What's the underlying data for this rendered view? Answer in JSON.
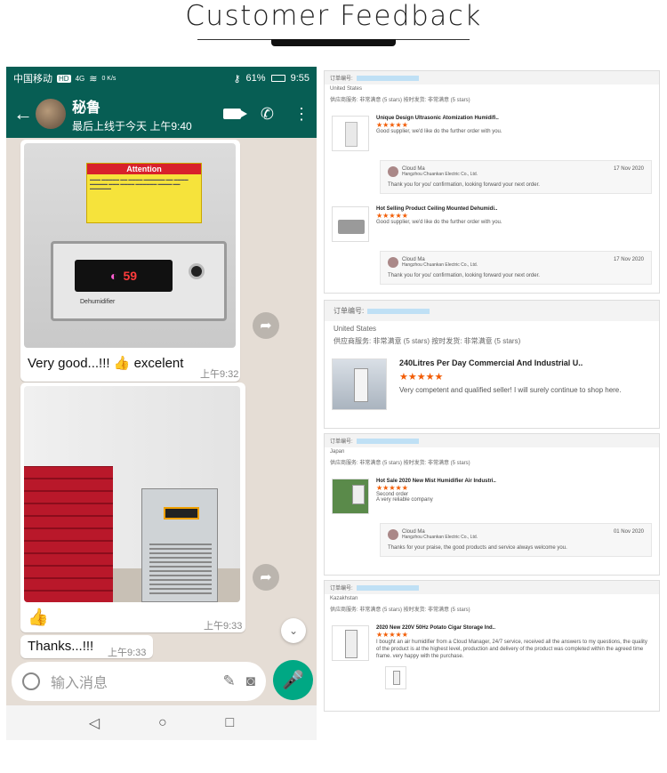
{
  "page": {
    "title": "Customer Feedback"
  },
  "phone": {
    "status": {
      "carrier": "中国移动",
      "hd": "HD",
      "net": "4G",
      "speed": "0 K/s",
      "battery": "61%",
      "time": "9:55"
    },
    "header": {
      "name": "秘鲁",
      "last_seen": "最后上线于今天 上午9:40"
    },
    "messages": [
      {
        "text": "Very good...!!! 👍 excelent",
        "time": "上午9:32",
        "display_text": "59"
      },
      {
        "emoji": "👍",
        "time": "上午9:33"
      },
      {
        "text": "Thanks...!!!",
        "time": "上午9:33"
      }
    ],
    "label_title": "Attention",
    "panel_brand": "Dehumidifier",
    "input_placeholder": "输入消息"
  },
  "reviews": [
    {
      "order_label": "订单编号:",
      "country": "United States",
      "meta": "供应商服务: 非常满意 (5 stars)    按时发货: 非常满意 (5 stars)",
      "items": [
        {
          "title": "Unique Design Ultrasonic Atomization Humidifi..",
          "stars": "★★★★★",
          "comment": "Good supplier, we'd like do the further order with you.",
          "reply": {
            "name": "Cloud Ma",
            "company": "Hangzhou Chuankan Electric Co., Ltd.",
            "date": "17 Nov 2020",
            "text": "Thank you for you' confirmation, looking forward your next order."
          }
        },
        {
          "title": "Hot Selling Product Ceiling Mounted Dehumidi..",
          "stars": "★★★★★",
          "comment": "Good supplier, we'd like do the further order with you.",
          "reply": {
            "name": "Cloud Ma",
            "company": "Hangzhou Chuankan Electric Co., Ltd.",
            "date": "17 Nov 2020",
            "text": "Thank you for you' confirmation, looking forward your next order."
          }
        }
      ]
    },
    {
      "order_label": "订单编号:",
      "country": "United States",
      "meta": "供应商服务: 非常满意 (5 stars)     按时发货: 非常满意 (5 stars)",
      "items": [
        {
          "title": "240Litres Per Day Commercial And Industrial U..",
          "stars": "★★★★★",
          "comment": "Very competent and qualified seller! I will surely continue to shop here."
        }
      ]
    },
    {
      "order_label": "订单编号:",
      "country": "Japan",
      "meta": "供应商服务: 非常满意 (5 stars)    按时发货: 非常满意 (5 stars)",
      "items": [
        {
          "title": "Hot Sale 2020 New Mist Humidifier Air Industri..",
          "stars": "★★★★★",
          "comment": "Second order\nA very reliable company",
          "reply": {
            "name": "Cloud Ma",
            "company": "Hangzhou Chuankan Electric Co., Ltd.",
            "date": "01 Nov 2020",
            "text": "Thanks for your praise, the good products and service always welcome you."
          }
        }
      ]
    },
    {
      "order_label": "订单编号:",
      "country": "Kazakhstan",
      "meta": "供应商服务: 非常满意 (5 stars)    按时发货: 非常满意 (5 stars)",
      "items": [
        {
          "title": "2020 New 220V 50Hz Potato Cigar Storage Ind..",
          "stars": "★★★★★",
          "comment": "I bought an air humidifier from a Cloud Manager, 24/7 service, received all the answers to my questions, the quality of the product is at the highest level, production and delivery of the product was completed within the agreed time frame. very happy with the purchase."
        }
      ]
    }
  ]
}
